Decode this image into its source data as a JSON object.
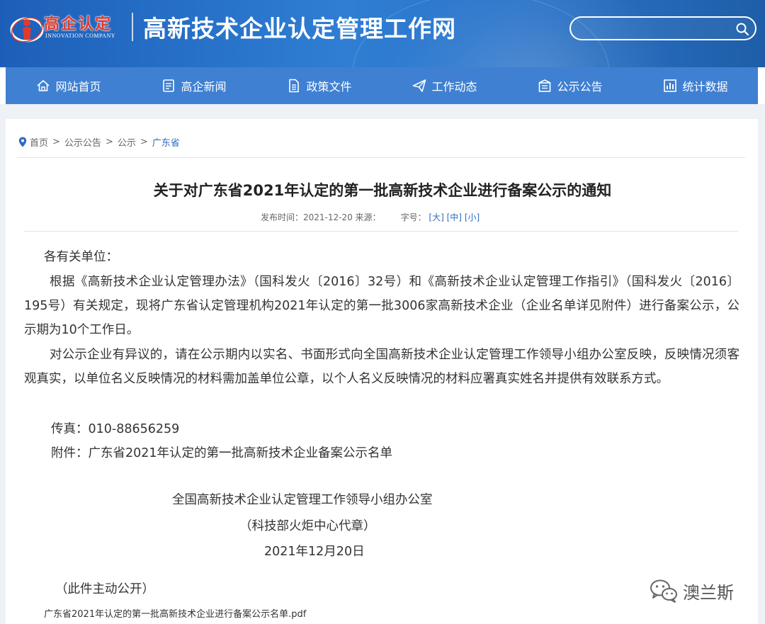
{
  "header": {
    "logo_text": "高企认定",
    "logo_sub": "INNOVATION COMPANY",
    "site_title": "高新技术企业认定管理工作网",
    "search_placeholder": ""
  },
  "nav": {
    "items": [
      {
        "label": "网站首页",
        "icon": "home-icon"
      },
      {
        "label": "高企新闻",
        "icon": "news-icon"
      },
      {
        "label": "政策文件",
        "icon": "document-icon"
      },
      {
        "label": "工作动态",
        "icon": "paper-plane-icon"
      },
      {
        "label": "公示公告",
        "icon": "announcement-icon"
      },
      {
        "label": "统计数据",
        "icon": "bar-chart-icon"
      }
    ]
  },
  "breadcrumb": {
    "home": "首页",
    "level1": "公示公告",
    "level2": "公示",
    "current": "广东省",
    "separator": ">"
  },
  "article": {
    "title": "关于对广东省2021年认定的第一批高新技术企业进行备案公示的通知",
    "publish_label": "发布时间：2021-12-20 来源：",
    "font_size_label": "字号：",
    "font_large": "[大]",
    "font_medium": "[中]",
    "font_small": "[小]",
    "salutation": "各有关单位：",
    "para1": "根据《高新技术企业认定管理办法》（国科发火〔2016〕32号）和《高新技术企业认定管理工作指引》（国科发火〔2016〕195号）有关规定，现将广东省认定管理机构2021年认定的第一批3006家高新技术企业（企业名单详见附件）进行备案公示，公示期为10个工作日。",
    "para2": "对公示企业有异议的，请在公示期内以实名、书面形式向全国高新技术企业认定管理工作领导小组办公室反映，反映情况须客观真实，以单位名义反映情况的材料需加盖单位公章，以个人名义反映情况的材料应署真实姓名并提供有效联系方式。",
    "fax": "传真：010-88656259",
    "attachment_line": "附件：广东省2021年认定的第一批高新技术企业备案公示名单",
    "signature_org": "全国高新技术企业认定管理工作领导小组办公室",
    "signature_sub": "（科技部火炬中心代章）",
    "signature_date": "2021年12月20日",
    "public_notice": "（此件主动公开）",
    "attachment_file": "广东省2021年认定的第一批高新技术企业进行备案公示名单.pdf"
  },
  "watermark": {
    "text": "澳兰斯"
  },
  "colors": {
    "header_bg": "#2f7ed4",
    "nav_bg": "#3f80d2",
    "logo_red": "#e03a2e",
    "link_blue": "#2d6bbf"
  }
}
